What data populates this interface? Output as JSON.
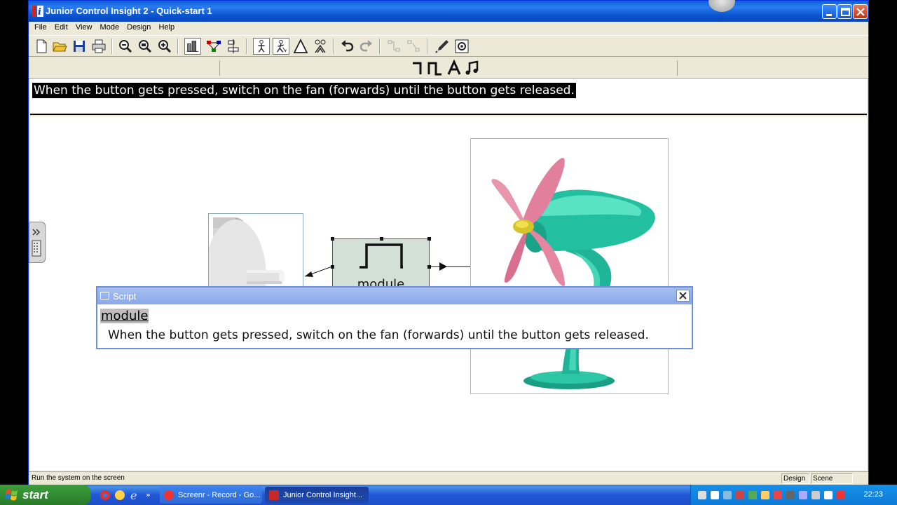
{
  "window": {
    "title": "Junior Control Insight 2 - Quick-start 1"
  },
  "menu": {
    "items": [
      "File",
      "Edit",
      "View",
      "Mode",
      "Design",
      "Help"
    ]
  },
  "toolbar": {
    "icons": [
      "new-icon",
      "open-icon",
      "save-icon",
      "print-icon",
      "zoom-out-icon",
      "zoom-fit-icon",
      "zoom-in-icon",
      "scene-icon",
      "connections-icon",
      "align-icon",
      "run-icon",
      "walk-icon",
      "triangle-icon",
      "animate-icon",
      "undo-icon",
      "redo-icon",
      "link-icon",
      "unlink-icon",
      "pen-icon",
      "settings-icon"
    ]
  },
  "description": {
    "text": "When the button gets pressed, switch on the fan (forwards) until the button gets released."
  },
  "module": {
    "label": "module"
  },
  "script": {
    "title": "Script",
    "heading": "module",
    "body": "When the button gets pressed, switch on the fan (forwards) until the button gets released."
  },
  "status": {
    "text": "Run the system on the screen",
    "mode": "Design",
    "view": "Scene"
  },
  "taskbar": {
    "start": "start",
    "tasks": [
      "Screenr - Record - Go...",
      "Junior Control Insight..."
    ],
    "clock": "22:23"
  }
}
